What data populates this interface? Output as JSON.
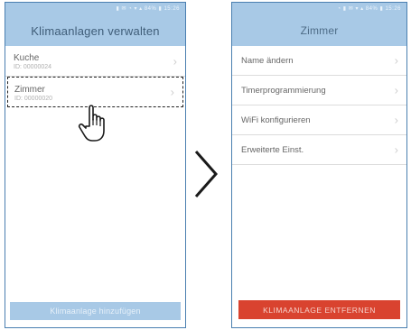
{
  "left_screen": {
    "status_text": "▮ ✉ ◔ ▾ ▴ 84% ▮ 15:26",
    "title": "Klimaanlagen verwalten",
    "devices": [
      {
        "name": "Kuche",
        "id": "ID: 00000024"
      },
      {
        "name": "Zimmer",
        "id": "ID: 00000020"
      }
    ],
    "selected_device_index": 1,
    "add_button_label": "Klimaanlage hinzufügen"
  },
  "right_screen": {
    "status_text": "◔ ▮ ✉ ▾ ▴ 84% ▮ 15:26",
    "title": "Zimmer",
    "menu_items": [
      "Name ändern",
      "Timerprogrammierung",
      "WiFi konfigurieren",
      "Erweiterte Einst."
    ],
    "remove_button_label": "KLIMAANLAGE ENTFERNEN"
  },
  "colors": {
    "header_bg": "#a8c9e6",
    "remove_button": "#d9432f",
    "frame_border": "#4a7fb0"
  },
  "icons": {
    "hand": "pointing-hand-cursor-icon",
    "chevron": "chevron-right-icon",
    "transition": "big-chevron-right-icon"
  }
}
